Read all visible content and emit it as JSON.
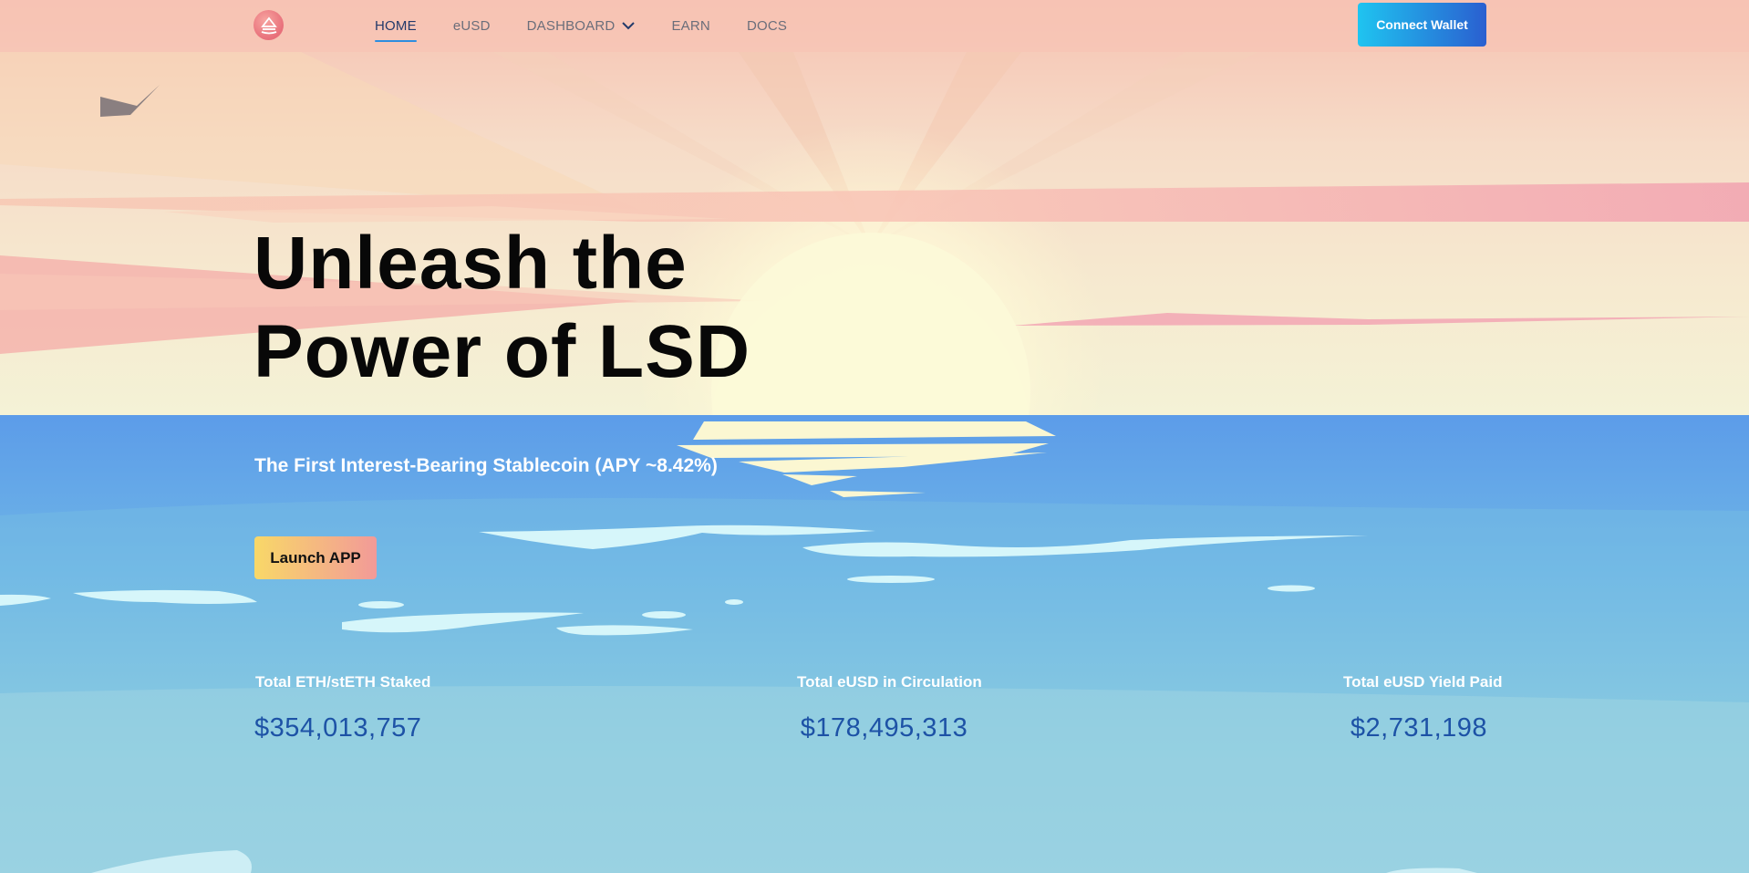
{
  "nav": {
    "items": [
      {
        "label": "HOME",
        "active": true
      },
      {
        "label": "eUSD",
        "active": false
      },
      {
        "label": "DASHBOARD",
        "active": false,
        "has_dropdown": true
      },
      {
        "label": "EARN",
        "active": false
      },
      {
        "label": "DOCS",
        "active": false
      }
    ],
    "connect_label": "Connect Wallet"
  },
  "hero": {
    "title_line1": "Unleash the",
    "title_line2": "Power of LSD",
    "subtitle": "The First Interest-Bearing Stablecoin (APY ~8.42%)",
    "launch_label": "Launch APP"
  },
  "stats": [
    {
      "label": "Total ETH/stETH Staked",
      "value": "$354,013,757"
    },
    {
      "label": "Total eUSD in Circulation",
      "value": "$178,495,313"
    },
    {
      "label": "Total eUSD Yield Paid",
      "value": "$2,731,198"
    }
  ],
  "colors": {
    "accent": "#2d8ee0",
    "stat_value": "#1d52a6",
    "sky_top": "#f6c7b6",
    "sky_horizon": "#f5f0d0",
    "sea_top": "#5b9ee8",
    "sea_bottom": "#9ad4e0"
  }
}
